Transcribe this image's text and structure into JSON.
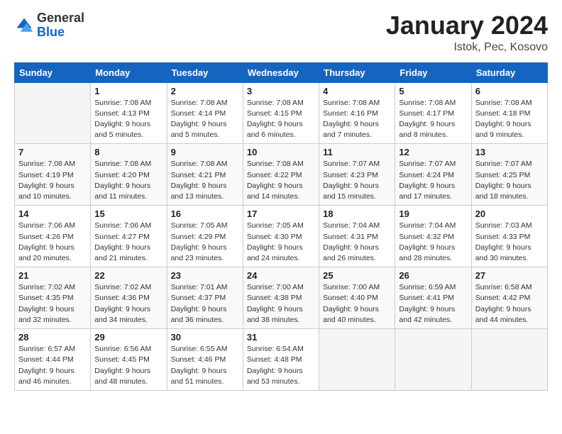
{
  "logo": {
    "general": "General",
    "blue": "Blue"
  },
  "header": {
    "month": "January 2024",
    "location": "Istok, Pec, Kosovo"
  },
  "weekdays": [
    "Sunday",
    "Monday",
    "Tuesday",
    "Wednesday",
    "Thursday",
    "Friday",
    "Saturday"
  ],
  "weeks": [
    [
      {
        "day": "",
        "empty": true
      },
      {
        "day": "1",
        "sunrise": "7:08 AM",
        "sunset": "4:13 PM",
        "daylight": "9 hours and 5 minutes."
      },
      {
        "day": "2",
        "sunrise": "7:08 AM",
        "sunset": "4:14 PM",
        "daylight": "9 hours and 5 minutes."
      },
      {
        "day": "3",
        "sunrise": "7:08 AM",
        "sunset": "4:15 PM",
        "daylight": "9 hours and 6 minutes."
      },
      {
        "day": "4",
        "sunrise": "7:08 AM",
        "sunset": "4:16 PM",
        "daylight": "9 hours and 7 minutes."
      },
      {
        "day": "5",
        "sunrise": "7:08 AM",
        "sunset": "4:17 PM",
        "daylight": "9 hours and 8 minutes."
      },
      {
        "day": "6",
        "sunrise": "7:08 AM",
        "sunset": "4:18 PM",
        "daylight": "9 hours and 9 minutes."
      }
    ],
    [
      {
        "day": "7",
        "sunrise": "7:08 AM",
        "sunset": "4:19 PM",
        "daylight": "9 hours and 10 minutes."
      },
      {
        "day": "8",
        "sunrise": "7:08 AM",
        "sunset": "4:20 PM",
        "daylight": "9 hours and 11 minutes."
      },
      {
        "day": "9",
        "sunrise": "7:08 AM",
        "sunset": "4:21 PM",
        "daylight": "9 hours and 13 minutes."
      },
      {
        "day": "10",
        "sunrise": "7:08 AM",
        "sunset": "4:22 PM",
        "daylight": "9 hours and 14 minutes."
      },
      {
        "day": "11",
        "sunrise": "7:07 AM",
        "sunset": "4:23 PM",
        "daylight": "9 hours and 15 minutes."
      },
      {
        "day": "12",
        "sunrise": "7:07 AM",
        "sunset": "4:24 PM",
        "daylight": "9 hours and 17 minutes."
      },
      {
        "day": "13",
        "sunrise": "7:07 AM",
        "sunset": "4:25 PM",
        "daylight": "9 hours and 18 minutes."
      }
    ],
    [
      {
        "day": "14",
        "sunrise": "7:06 AM",
        "sunset": "4:26 PM",
        "daylight": "9 hours and 20 minutes."
      },
      {
        "day": "15",
        "sunrise": "7:06 AM",
        "sunset": "4:27 PM",
        "daylight": "9 hours and 21 minutes."
      },
      {
        "day": "16",
        "sunrise": "7:05 AM",
        "sunset": "4:29 PM",
        "daylight": "9 hours and 23 minutes."
      },
      {
        "day": "17",
        "sunrise": "7:05 AM",
        "sunset": "4:30 PM",
        "daylight": "9 hours and 24 minutes."
      },
      {
        "day": "18",
        "sunrise": "7:04 AM",
        "sunset": "4:31 PM",
        "daylight": "9 hours and 26 minutes."
      },
      {
        "day": "19",
        "sunrise": "7:04 AM",
        "sunset": "4:32 PM",
        "daylight": "9 hours and 28 minutes."
      },
      {
        "day": "20",
        "sunrise": "7:03 AM",
        "sunset": "4:33 PM",
        "daylight": "9 hours and 30 minutes."
      }
    ],
    [
      {
        "day": "21",
        "sunrise": "7:02 AM",
        "sunset": "4:35 PM",
        "daylight": "9 hours and 32 minutes."
      },
      {
        "day": "22",
        "sunrise": "7:02 AM",
        "sunset": "4:36 PM",
        "daylight": "9 hours and 34 minutes."
      },
      {
        "day": "23",
        "sunrise": "7:01 AM",
        "sunset": "4:37 PM",
        "daylight": "9 hours and 36 minutes."
      },
      {
        "day": "24",
        "sunrise": "7:00 AM",
        "sunset": "4:38 PM",
        "daylight": "9 hours and 38 minutes."
      },
      {
        "day": "25",
        "sunrise": "7:00 AM",
        "sunset": "4:40 PM",
        "daylight": "9 hours and 40 minutes."
      },
      {
        "day": "26",
        "sunrise": "6:59 AM",
        "sunset": "4:41 PM",
        "daylight": "9 hours and 42 minutes."
      },
      {
        "day": "27",
        "sunrise": "6:58 AM",
        "sunset": "4:42 PM",
        "daylight": "9 hours and 44 minutes."
      }
    ],
    [
      {
        "day": "28",
        "sunrise": "6:57 AM",
        "sunset": "4:44 PM",
        "daylight": "9 hours and 46 minutes."
      },
      {
        "day": "29",
        "sunrise": "6:56 AM",
        "sunset": "4:45 PM",
        "daylight": "9 hours and 48 minutes."
      },
      {
        "day": "30",
        "sunrise": "6:55 AM",
        "sunset": "4:46 PM",
        "daylight": "9 hours and 51 minutes."
      },
      {
        "day": "31",
        "sunrise": "6:54 AM",
        "sunset": "4:48 PM",
        "daylight": "9 hours and 53 minutes."
      },
      {
        "day": "",
        "empty": true
      },
      {
        "day": "",
        "empty": true
      },
      {
        "day": "",
        "empty": true
      }
    ]
  ]
}
